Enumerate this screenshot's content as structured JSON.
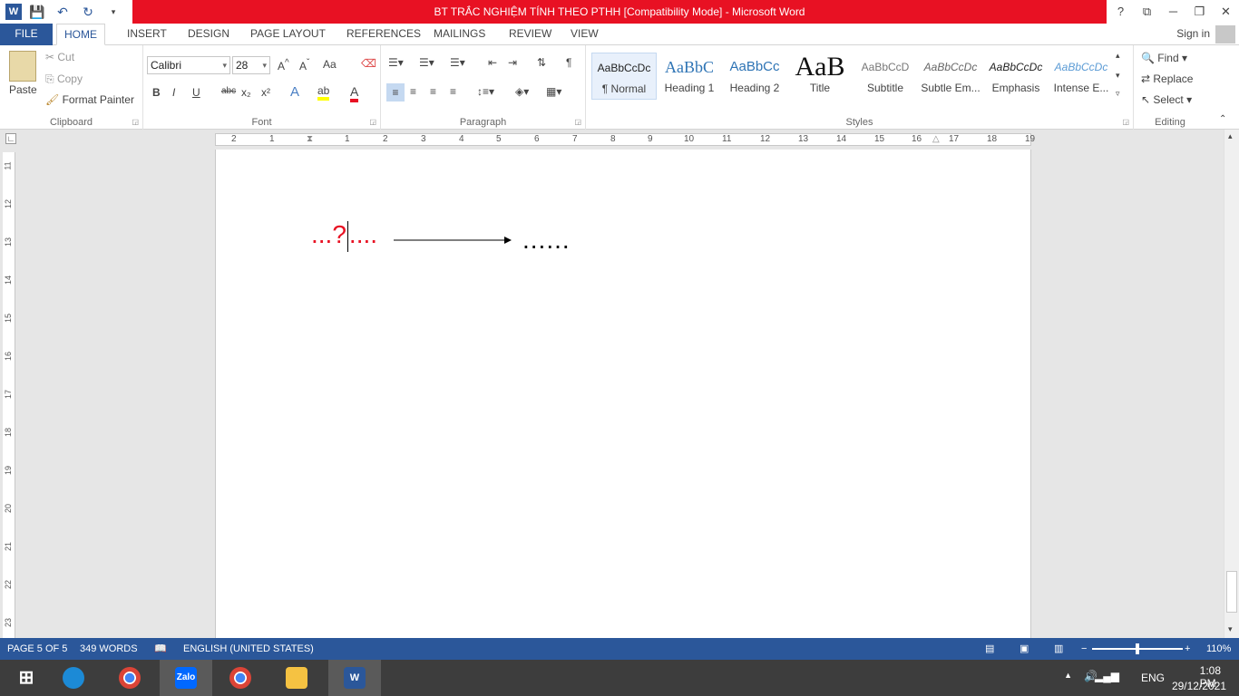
{
  "window": {
    "title": "BT TRẮC NGHIỆM  TÍNH THEO PTHH [Compatibility Mode] -  Microsoft Word",
    "help": "?",
    "sign_in": "Sign in"
  },
  "tabs": [
    "FILE",
    "HOME",
    "INSERT",
    "DESIGN",
    "PAGE LAYOUT",
    "REFERENCES",
    "MAILINGS",
    "REVIEW",
    "VIEW"
  ],
  "ribbon": {
    "clipboard": {
      "paste": "Paste",
      "cut": "Cut",
      "copy": "Copy",
      "format_painter": "Format Painter",
      "label": "Clipboard"
    },
    "font": {
      "name": "Calibri",
      "size": "28",
      "label": "Font",
      "change_case": "Aa"
    },
    "paragraph": {
      "label": "Paragraph"
    },
    "styles": {
      "label": "Styles",
      "items": [
        {
          "preview": "AaBbCcDc",
          "name": "¶ Normal"
        },
        {
          "preview": "AaBbC",
          "name": "Heading 1"
        },
        {
          "preview": "AaBbCc",
          "name": "Heading 2"
        },
        {
          "preview": "AaB",
          "name": "Title"
        },
        {
          "preview": "AaBbCcD",
          "name": "Subtitle"
        },
        {
          "preview": "AaBbCcDc",
          "name": "Subtle Em..."
        },
        {
          "preview": "AaBbCcDc",
          "name": "Emphasis"
        },
        {
          "preview": "AaBbCcDc",
          "name": "Intense E..."
        }
      ]
    },
    "editing": {
      "find": "Find",
      "replace": "Replace",
      "select": "Select",
      "label": "Editing"
    }
  },
  "ruler": {
    "h_ticks": [
      "2",
      "1",
      "1",
      "2",
      "3",
      "4",
      "5",
      "6",
      "7",
      "8",
      "9",
      "10",
      "11",
      "12",
      "13",
      "14",
      "15",
      "16",
      "17",
      "18",
      "19"
    ],
    "v_ticks": [
      "11",
      "12",
      "13",
      "14",
      "15",
      "16",
      "17",
      "18",
      "19",
      "20",
      "21",
      "22",
      "23"
    ]
  },
  "document": {
    "left_text_a": "...",
    "question": "?",
    "left_text_b": "....",
    "right_text": "......"
  },
  "status": {
    "page": "PAGE 5 OF 5",
    "words": "349 WORDS",
    "language": "ENGLISH (UNITED STATES)",
    "zoom": "110%"
  },
  "taskbar": {
    "lang": "ENG",
    "time": "1:08 PM",
    "date": "29/12/2021",
    "zalo": "Zalo",
    "word": "W"
  },
  "colors": {
    "brand": "#2b579a",
    "title_red": "#e81123",
    "doc_red": "#e81123"
  }
}
